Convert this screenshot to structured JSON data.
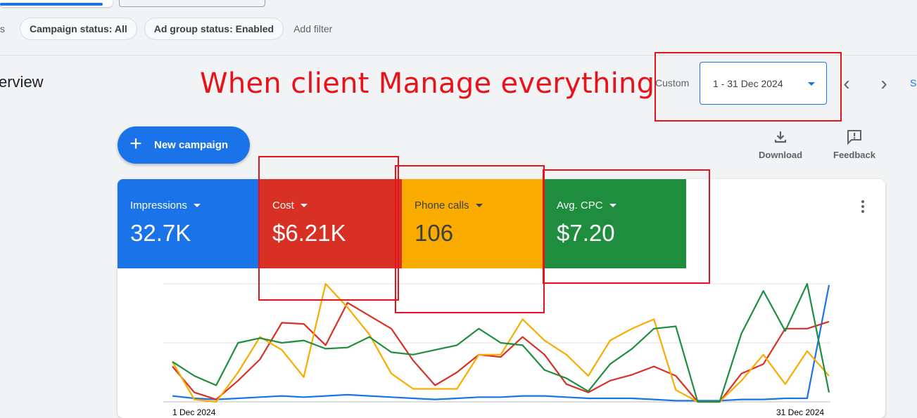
{
  "filters": {
    "cut_text": "s",
    "chips": [
      "Campaign status: All",
      "Ad group status: Enabled"
    ],
    "add_filter": "Add filter"
  },
  "overview": {
    "title": "erview"
  },
  "annotation": {
    "text": "When client Manage everything"
  },
  "date_range": {
    "label": "Custom",
    "value": "1 - 31 Dec 2024",
    "prev_icon": "chevron-left-icon",
    "next_icon": "chevron-right-icon",
    "cut_link": "S"
  },
  "actions": {
    "new_campaign": "New campaign",
    "download": "Download",
    "feedback": "Feedback"
  },
  "metrics": [
    {
      "label": "Impressions",
      "value": "32.7K",
      "bg": "#1a73e8",
      "fg": "#ffffff"
    },
    {
      "label": "Cost",
      "value": "$6.21K",
      "bg": "#d93025",
      "fg": "#ffffff"
    },
    {
      "label": "Phone calls",
      "value": "106",
      "bg": "#f9ab00",
      "fg": "#3c4043"
    },
    {
      "label": "Avg. CPC",
      "value": "$7.20",
      "bg": "#1e8e3e",
      "fg": "#ffffff"
    }
  ],
  "chart_data": {
    "type": "line",
    "x_labels": [
      "1 Dec 2024",
      "31 Dec 2024"
    ],
    "x": [
      1,
      2,
      3,
      4,
      5,
      6,
      7,
      8,
      9,
      10,
      11,
      12,
      13,
      14,
      15,
      16,
      17,
      18,
      19,
      20,
      21,
      22,
      23,
      24,
      25,
      26,
      27,
      28,
      29,
      30,
      31
    ],
    "ylim": [
      0,
      100
    ],
    "grid": true,
    "series": [
      {
        "color": "#1a73e8",
        "values": [
          5,
          3,
          2,
          3,
          4,
          5,
          4,
          5,
          6,
          5,
          4,
          3,
          2,
          3,
          4,
          4,
          5,
          5,
          4,
          3,
          3,
          3,
          2,
          1,
          1,
          1,
          2,
          2,
          3,
          3,
          99
        ]
      },
      {
        "color": "#d93025",
        "values": [
          30,
          8,
          2,
          18,
          36,
          67,
          66,
          48,
          84,
          73,
          62,
          35,
          14,
          25,
          40,
          38,
          55,
          40,
          15,
          8,
          18,
          23,
          30,
          22,
          0,
          0,
          24,
          32,
          62,
          62,
          68
        ]
      },
      {
        "color": "#f9ab00",
        "values": [
          34,
          2,
          0,
          25,
          55,
          44,
          21,
          100,
          80,
          57,
          24,
          11,
          11,
          11,
          40,
          40,
          70,
          52,
          40,
          22,
          52,
          62,
          70,
          10,
          0,
          0,
          18,
          40,
          15,
          43,
          22
        ]
      },
      {
        "color": "#1e8e3e",
        "values": [
          34,
          22,
          14,
          50,
          54,
          50,
          52,
          45,
          46,
          55,
          42,
          40,
          44,
          48,
          62,
          50,
          48,
          27,
          20,
          9,
          32,
          45,
          62,
          64,
          0,
          0,
          58,
          94,
          60,
          100,
          8
        ]
      }
    ]
  }
}
